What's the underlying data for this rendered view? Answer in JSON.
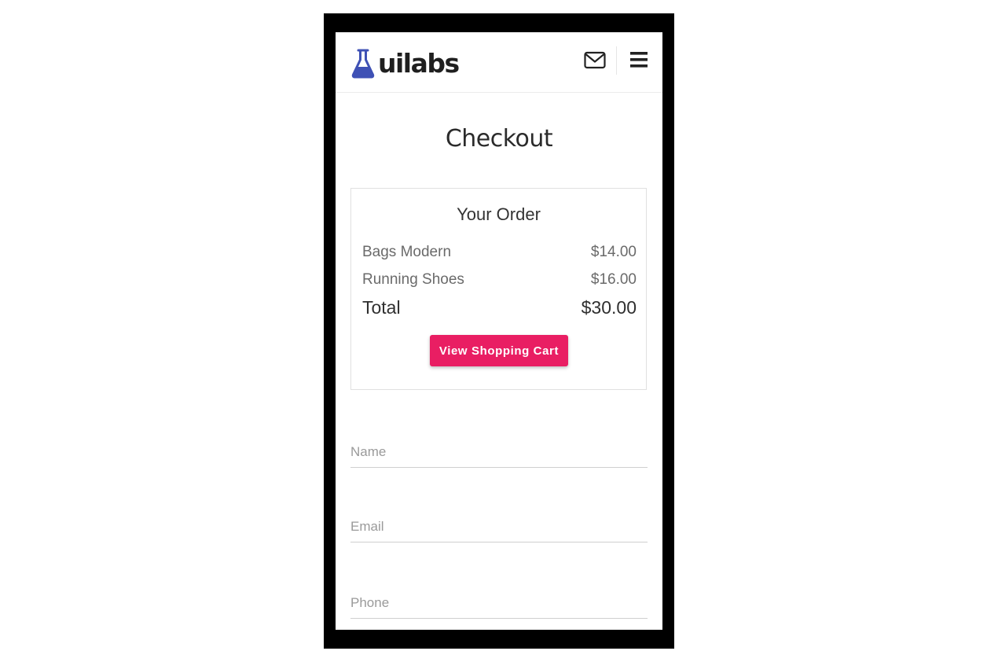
{
  "brand": {
    "logo_text": "uilabs",
    "logo_icon": "flask-icon",
    "accent_color": "#3f51b5"
  },
  "header": {
    "mail_icon": "envelope-icon",
    "menu_icon": "hamburger-menu-icon"
  },
  "page": {
    "title": "Checkout"
  },
  "order": {
    "title": "Your Order",
    "items": [
      {
        "name": "Bags Modern",
        "price": "$14.00"
      },
      {
        "name": "Running Shoes",
        "price": "$16.00"
      }
    ],
    "total_label": "Total",
    "total_value": "$30.00",
    "cart_button_label": "View Shopping Cart",
    "cart_button_color": "#e91e63"
  },
  "form": {
    "name_placeholder": "Name",
    "email_placeholder": "Email",
    "phone_placeholder": "Phone"
  }
}
